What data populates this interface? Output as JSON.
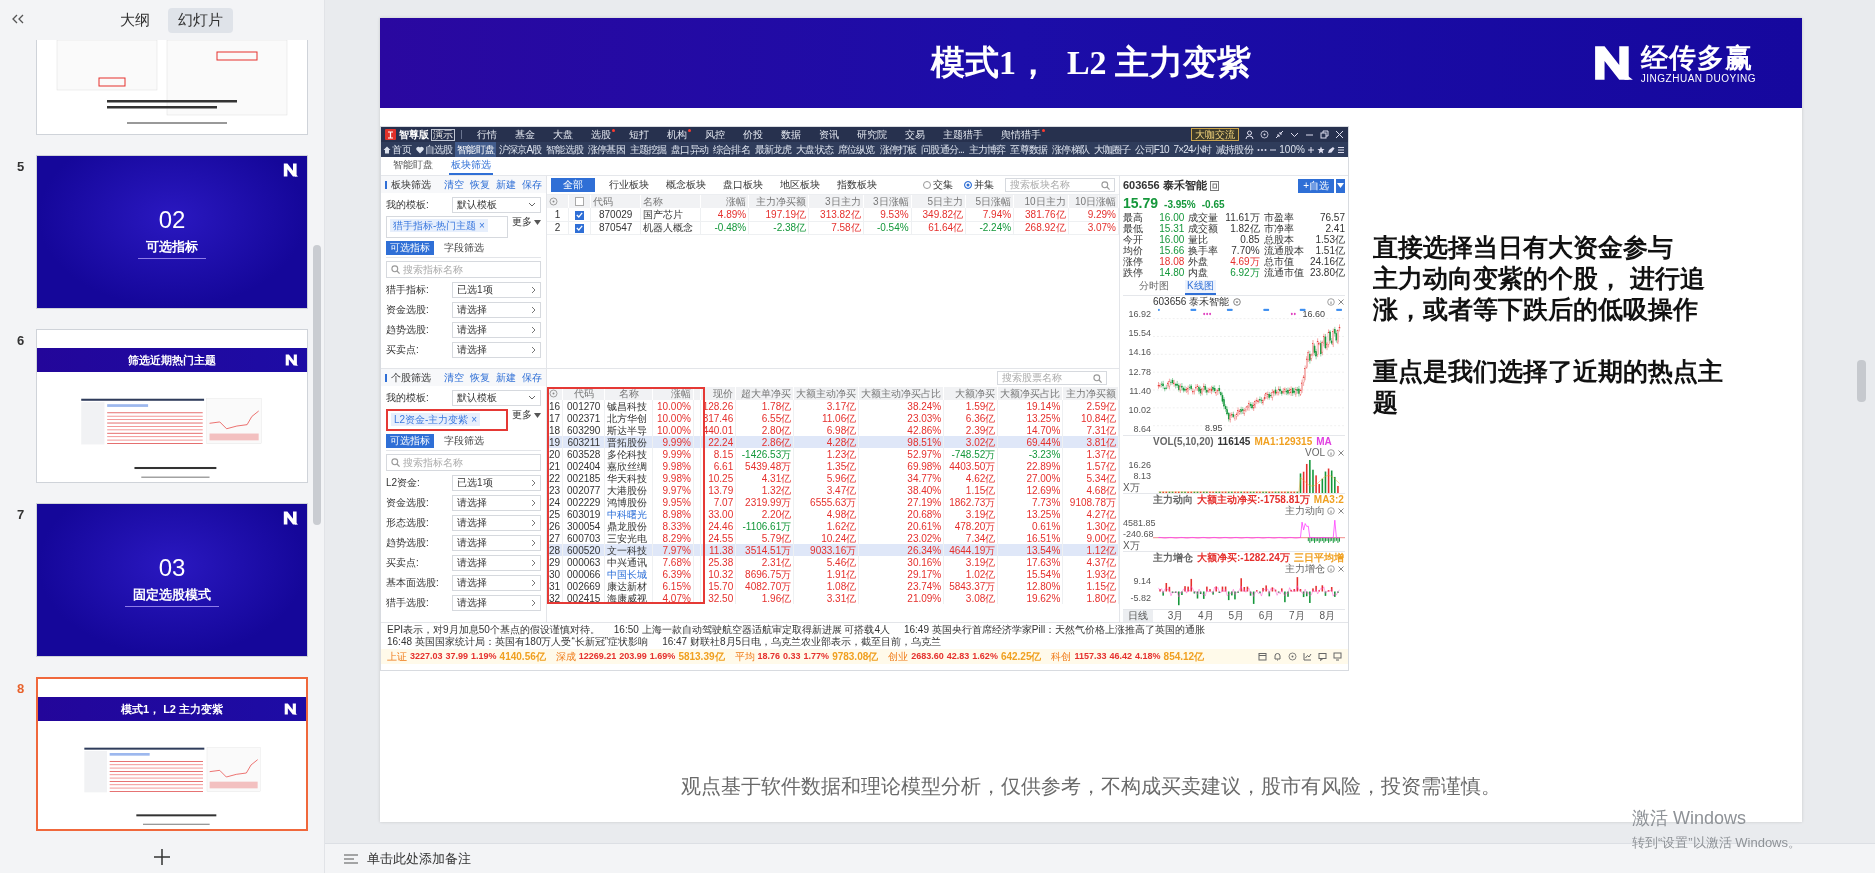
{
  "left_panel": {
    "tabs": [
      {
        "label": "大纲",
        "selected": false
      },
      {
        "label": "幻灯片",
        "selected": true
      }
    ],
    "slides": [
      {
        "kind": "partial",
        "selected": false
      },
      {
        "kind": "section",
        "number": "5",
        "heading": "02",
        "title": "可选指标",
        "selected": false
      },
      {
        "kind": "content",
        "number": "6",
        "title": "筛选近期热门主题",
        "selected": false
      },
      {
        "kind": "section",
        "number": "7",
        "heading": "03",
        "title": "固定选股模式",
        "selected": false
      },
      {
        "kind": "content",
        "number": "8",
        "title": "模式1， L2 主力变紫",
        "selected": true
      }
    ]
  },
  "notes": {
    "placeholder": "单击此处添加备注"
  },
  "activation": {
    "title": "激活 Windows",
    "hint": "转到“设置”以激活 Windows。"
  },
  "slide": {
    "title": "模式1，  L2 主力变紫",
    "logo": {
      "name": "经传多赢",
      "subtitle": "JINGZHUAN DUOYING"
    },
    "paragraphs": [
      [
        "直接选择当日有大资金参与",
        "主力动向变紫的个股， 进行追",
        "涨，或者等下跌后的低吸操作"
      ],
      [
        "重点是我们选择了近期的热点主",
        "题"
      ]
    ],
    "footer": "观点基于软件数据和理论模型分析，仅供参考，不构成买卖建议，股市有风险，投资需谨慎。"
  },
  "app": {
    "brand": "智尊版",
    "badge": "演示",
    "menu": [
      {
        "label": "行情",
        "dot": false
      },
      {
        "label": "基金",
        "dot": false
      },
      {
        "label": "大盘",
        "dot": false
      },
      {
        "label": "选股",
        "dot": true
      },
      {
        "label": "短打",
        "dot": false
      },
      {
        "label": "机构",
        "dot": true
      },
      {
        "label": "风控",
        "dot": false
      },
      {
        "label": "价投",
        "dot": false
      },
      {
        "label": "数据",
        "dot": false
      },
      {
        "label": "资讯",
        "dot": false
      },
      {
        "label": "研究院",
        "dot": false
      },
      {
        "label": "交易",
        "dot": false
      },
      {
        "label": "主题猎手",
        "dot": false
      },
      {
        "label": "舆情猎手",
        "dot": true
      }
    ],
    "community_button": "大咖交流",
    "nav": [
      {
        "label": "首页",
        "selected": false
      },
      {
        "label": "自选股",
        "selected": false
      },
      {
        "label": "智能盯盘",
        "selected": true
      },
      {
        "label": "沪深京A股",
        "selected": false
      },
      {
        "label": "智能选股",
        "selected": false
      },
      {
        "label": "涨停基因",
        "selected": false
      },
      {
        "label": "主题挖掘",
        "selected": false
      },
      {
        "label": "盘口异动",
        "selected": false
      },
      {
        "label": "综合排名",
        "selected": false
      },
      {
        "label": "最新龙虎",
        "selected": false
      },
      {
        "label": "大盘状态",
        "selected": false
      },
      {
        "label": "席位纵览",
        "selected": false
      },
      {
        "label": "涨停打板",
        "selected": false
      },
      {
        "label": "问股通分...",
        "selected": false
      },
      {
        "label": "主力博弈",
        "selected": false
      },
      {
        "label": "至尊数据",
        "selected": false
      },
      {
        "label": "涨停梯队",
        "selected": false
      },
      {
        "label": "大咖圈子",
        "selected": false
      },
      {
        "label": "公司F10",
        "selected": false
      },
      {
        "label": "7×24小时",
        "selected": false
      },
      {
        "label": "减持股份",
        "selected": false
      }
    ],
    "zoom": "100%",
    "tabs": [
      {
        "label": "智能盯盘",
        "selected": false
      },
      {
        "label": "板块筛选",
        "selected": true
      }
    ],
    "sector_filter": {
      "title": "板块筛选",
      "actions": [
        "清空",
        "恢复",
        "新建",
        "保存"
      ],
      "template_label": "我的模板:",
      "template": "默认模板",
      "tag": "猎手指标-热门主题 ×",
      "tag_highlighted": false,
      "more": "更多",
      "tabs": [
        {
          "label": "可选指标",
          "selected": true
        },
        {
          "label": "字段筛选",
          "selected": false
        }
      ],
      "search_placeholder": "搜索指标名称",
      "rows": [
        {
          "label": "猎手指标:",
          "value": "已选1项"
        },
        {
          "label": "资金选股:",
          "value": "请选择"
        },
        {
          "label": "趋势选股:",
          "value": "请选择"
        },
        {
          "label": "买卖点:",
          "value": "请选择"
        }
      ]
    },
    "stock_filter": {
      "title": "个股筛选",
      "actions": [
        "清空",
        "恢复",
        "新建",
        "保存"
      ],
      "template_label": "我的模板:",
      "template": "默认模板",
      "tag": "L2资金-主力变紫 ×",
      "tag_highlighted": true,
      "more": "更多",
      "tabs": [
        {
          "label": "可选指标",
          "selected": true
        },
        {
          "label": "字段筛选",
          "selected": false
        }
      ],
      "search_placeholder": "搜索指标名称",
      "rows": [
        {
          "label": "L2资金:",
          "value": "已选1项"
        },
        {
          "label": "资金选股:",
          "value": "请选择"
        },
        {
          "label": "形态选股:",
          "value": "请选择"
        },
        {
          "label": "趋势选股:",
          "value": "请选择"
        },
        {
          "label": "买卖点:",
          "value": "请选择"
        },
        {
          "label": "基本面选股:",
          "value": "请选择"
        },
        {
          "label": "猎手选股:",
          "value": "请选择"
        }
      ]
    },
    "sector_table": {
      "categories": [
        {
          "label": "全部",
          "selected": true
        },
        {
          "label": "行业板块",
          "selected": false
        },
        {
          "label": "概念板块",
          "selected": false
        },
        {
          "label": "盘口板块",
          "selected": false
        },
        {
          "label": "地区板块",
          "selected": false
        },
        {
          "label": "指数板块",
          "selected": false
        }
      ],
      "modes": [
        {
          "label": "交集",
          "selected": false
        },
        {
          "label": "并集",
          "selected": true
        }
      ],
      "search_placeholder": "搜索板块名称",
      "all_checked": false,
      "columns": [
        "代码",
        "名称",
        "涨幅",
        "主力净买额",
        "3日主力",
        "3日涨幅",
        "5日主力",
        "5日涨幅",
        "10日主力",
        "10日涨幅"
      ],
      "rows": [
        {
          "index": "1",
          "checked": true,
          "cells": [
            {
              "text": "870029"
            },
            {
              "text": "国产芯片"
            },
            {
              "text": "4.89%",
              "up": true
            },
            {
              "text": "197.19亿",
              "up": true
            },
            {
              "text": "313.82亿",
              "up": true
            },
            {
              "text": "9.53%",
              "up": true
            },
            {
              "text": "349.82亿",
              "up": true
            },
            {
              "text": "7.94%",
              "up": true
            },
            {
              "text": "381.76亿",
              "up": true
            },
            {
              "text": "9.29%",
              "up": true
            }
          ]
        },
        {
          "index": "2",
          "checked": true,
          "cells": [
            {
              "text": "870547"
            },
            {
              "text": "机器人概念"
            },
            {
              "text": "-0.48%",
              "up": false
            },
            {
              "text": "-2.38亿",
              "up": false
            },
            {
              "text": "7.58亿",
              "up": true
            },
            {
              "text": "-0.54%",
              "up": false
            },
            {
              "text": "61.64亿",
              "up": true
            },
            {
              "text": "-2.24%",
              "up": false
            },
            {
              "text": "268.92亿",
              "up": true
            },
            {
              "text": "3.07%",
              "up": true
            }
          ]
        }
      ]
    },
    "stock_table": {
      "search_placeholder": "搜索股票名称",
      "highlighted": true,
      "columns": [
        "代码",
        "名称",
        "涨幅",
        "现价",
        "超大单净买",
        "大额主动净买",
        "大额主动净买占比",
        "大额净买",
        "大额净买占比",
        "主力净买额"
      ],
      "rows": [
        {
          "index": "16",
          "selected": false,
          "cells": [
            {
              "text": "001270"
            },
            {
              "text": "铖昌科技"
            },
            {
              "text": "10.00%",
              "up": true
            },
            {
              "text": "128.26",
              "up": true
            },
            {
              "text": "1.78亿",
              "up": true
            },
            {
              "text": "3.17亿",
              "up": true
            },
            {
              "text": "38.24%",
              "up": true
            },
            {
              "text": "1.59亿",
              "up": true
            },
            {
              "text": "19.14%",
              "up": true
            },
            {
              "text": "2.59亿",
              "up": true
            }
          ]
        },
        {
          "index": "17",
          "selected": false,
          "cells": [
            {
              "text": "002371"
            },
            {
              "text": "北方华创"
            },
            {
              "text": "10.00%",
              "up": true
            },
            {
              "text": "317.46",
              "up": true
            },
            {
              "text": "6.55亿",
              "up": true
            },
            {
              "text": "11.06亿",
              "up": true
            },
            {
              "text": "23.03%",
              "up": true
            },
            {
              "text": "6.36亿",
              "up": true
            },
            {
              "text": "13.25%",
              "up": true
            },
            {
              "text": "10.84亿",
              "up": true
            }
          ]
        },
        {
          "index": "18",
          "selected": false,
          "cells": [
            {
              "text": "603290"
            },
            {
              "text": "斯达半导"
            },
            {
              "text": "10.00%",
              "up": true
            },
            {
              "text": "440.01",
              "up": true
            },
            {
              "text": "2.80亿",
              "up": true
            },
            {
              "text": "6.98亿",
              "up": true
            },
            {
              "text": "42.86%",
              "up": true
            },
            {
              "text": "2.39亿",
              "up": true
            },
            {
              "text": "14.70%",
              "up": true
            },
            {
              "text": "7.31亿",
              "up": true
            }
          ]
        },
        {
          "index": "19",
          "selected": true,
          "cells": [
            {
              "text": "603211"
            },
            {
              "text": "晋拓股份"
            },
            {
              "text": "9.99%",
              "up": true
            },
            {
              "text": "22.24",
              "up": true
            },
            {
              "text": "2.86亿",
              "up": true
            },
            {
              "text": "4.28亿",
              "up": true
            },
            {
              "text": "98.51%",
              "up": true
            },
            {
              "text": "3.02亿",
              "up": true
            },
            {
              "text": "69.44%",
              "up": true
            },
            {
              "text": "3.81亿",
              "up": true
            }
          ]
        },
        {
          "index": "20",
          "selected": false,
          "cells": [
            {
              "text": "603528"
            },
            {
              "text": "多伦科技"
            },
            {
              "text": "9.99%",
              "up": true
            },
            {
              "text": "8.15",
              "up": true
            },
            {
              "text": "-1426.53万",
              "up": false
            },
            {
              "text": "1.23亿",
              "up": true
            },
            {
              "text": "52.97%",
              "up": true
            },
            {
              "text": "-748.52万",
              "up": false
            },
            {
              "text": "-3.23%",
              "up": false
            },
            {
              "text": "1.37亿",
              "up": true
            }
          ]
        },
        {
          "index": "21",
          "selected": false,
          "cells": [
            {
              "text": "002404"
            },
            {
              "text": "嘉欣丝绸"
            },
            {
              "text": "9.98%",
              "up": true
            },
            {
              "text": "6.61",
              "up": true
            },
            {
              "text": "5439.48万",
              "up": true
            },
            {
              "text": "1.35亿",
              "up": true
            },
            {
              "text": "69.98%",
              "up": true
            },
            {
              "text": "4403.50万",
              "up": true
            },
            {
              "text": "22.89%",
              "up": true
            },
            {
              "text": "1.57亿",
              "up": true
            }
          ]
        },
        {
          "index": "22",
          "selected": false,
          "cells": [
            {
              "text": "002185"
            },
            {
              "text": "华天科技"
            },
            {
              "text": "9.98%",
              "up": true
            },
            {
              "text": "10.25",
              "up": true
            },
            {
              "text": "4.31亿",
              "up": true
            },
            {
              "text": "5.96亿",
              "up": true
            },
            {
              "text": "34.77%",
              "up": true
            },
            {
              "text": "4.62亿",
              "up": true
            },
            {
              "text": "27.00%",
              "up": true
            },
            {
              "text": "5.34亿",
              "up": true
            }
          ]
        },
        {
          "index": "23",
          "selected": false,
          "cells": [
            {
              "text": "002077"
            },
            {
              "text": "大港股份"
            },
            {
              "text": "9.97%",
              "up": true
            },
            {
              "text": "13.79",
              "up": true
            },
            {
              "text": "1.32亿",
              "up": true
            },
            {
              "text": "3.47亿",
              "up": true
            },
            {
              "text": "38.40%",
              "up": true
            },
            {
              "text": "1.15亿",
              "up": true
            },
            {
              "text": "12.69%",
              "up": true
            },
            {
              "text": "4.68亿",
              "up": true
            }
          ]
        },
        {
          "index": "24",
          "selected": false,
          "cells": [
            {
              "text": "002229"
            },
            {
              "text": "鸿博股份"
            },
            {
              "text": "9.95%",
              "up": true
            },
            {
              "text": "7.07",
              "up": true
            },
            {
              "text": "2319.99万",
              "up": true
            },
            {
              "text": "6555.63万",
              "up": true
            },
            {
              "text": "27.19%",
              "up": true
            },
            {
              "text": "1862.73万",
              "up": true
            },
            {
              "text": "7.73%",
              "up": true
            },
            {
              "text": "9108.78万",
              "up": true
            }
          ]
        },
        {
          "index": "25",
          "selected": false,
          "cells": [
            {
              "text": "603019"
            },
            {
              "text": "中科曙光",
              "marked": true
            },
            {
              "text": "8.98%",
              "up": true
            },
            {
              "text": "33.00",
              "up": true
            },
            {
              "text": "2.20亿",
              "up": true
            },
            {
              "text": "4.98亿",
              "up": true
            },
            {
              "text": "20.68%",
              "up": true
            },
            {
              "text": "3.19亿",
              "up": true
            },
            {
              "text": "13.25%",
              "up": true
            },
            {
              "text": "4.27亿",
              "up": true
            }
          ]
        },
        {
          "index": "26",
          "selected": false,
          "cells": [
            {
              "text": "300054"
            },
            {
              "text": "鼎龙股份"
            },
            {
              "text": "8.33%",
              "up": true
            },
            {
              "text": "24.46",
              "up": true
            },
            {
              "text": "-1106.61万",
              "up": false
            },
            {
              "text": "1.62亿",
              "up": true
            },
            {
              "text": "20.61%",
              "up": true
            },
            {
              "text": "478.20万",
              "up": true
            },
            {
              "text": "0.61%",
              "up": true
            },
            {
              "text": "1.30亿",
              "up": true
            }
          ]
        },
        {
          "index": "27",
          "selected": false,
          "cells": [
            {
              "text": "600703"
            },
            {
              "text": "三安光电"
            },
            {
              "text": "8.29%",
              "up": true
            },
            {
              "text": "24.55",
              "up": true
            },
            {
              "text": "5.79亿",
              "up": true
            },
            {
              "text": "10.24亿",
              "up": true
            },
            {
              "text": "23.02%",
              "up": true
            },
            {
              "text": "7.34亿",
              "up": true
            },
            {
              "text": "16.51%",
              "up": true
            },
            {
              "text": "9.00亿",
              "up": true
            }
          ]
        },
        {
          "index": "28",
          "selected": true,
          "cells": [
            {
              "text": "600520"
            },
            {
              "text": "文一科技"
            },
            {
              "text": "7.97%",
              "up": true
            },
            {
              "text": "11.38",
              "up": true
            },
            {
              "text": "3514.51万",
              "up": true
            },
            {
              "text": "9033.16万",
              "up": true
            },
            {
              "text": "26.34%",
              "up": true
            },
            {
              "text": "4644.19万",
              "up": true
            },
            {
              "text": "13.54%",
              "up": true
            },
            {
              "text": "1.12亿",
              "up": true
            }
          ]
        },
        {
          "index": "29",
          "selected": false,
          "cells": [
            {
              "text": "000063"
            },
            {
              "text": "中兴通讯"
            },
            {
              "text": "7.68%",
              "up": true
            },
            {
              "text": "25.38",
              "up": true
            },
            {
              "text": "2.31亿",
              "up": true
            },
            {
              "text": "5.46亿",
              "up": true
            },
            {
              "text": "30.16%",
              "up": true
            },
            {
              "text": "3.19亿",
              "up": true
            },
            {
              "text": "17.63%",
              "up": true
            },
            {
              "text": "4.37亿",
              "up": true
            }
          ]
        },
        {
          "index": "30",
          "selected": false,
          "cells": [
            {
              "text": "000066"
            },
            {
              "text": "中国长城",
              "marked": true
            },
            {
              "text": "6.39%",
              "up": true
            },
            {
              "text": "10.32",
              "up": true
            },
            {
              "text": "8696.75万",
              "up": true
            },
            {
              "text": "1.91亿",
              "up": true
            },
            {
              "text": "29.17%",
              "up": true
            },
            {
              "text": "1.02亿",
              "up": true
            },
            {
              "text": "15.54%",
              "up": true
            },
            {
              "text": "1.93亿",
              "up": true
            }
          ]
        },
        {
          "index": "31",
          "selected": false,
          "cells": [
            {
              "text": "002669"
            },
            {
              "text": "康达新材"
            },
            {
              "text": "6.15%",
              "up": true
            },
            {
              "text": "15.70",
              "up": true
            },
            {
              "text": "4082.70万",
              "up": true
            },
            {
              "text": "1.08亿",
              "up": true
            },
            {
              "text": "23.74%",
              "up": true
            },
            {
              "text": "5843.37万",
              "up": true
            },
            {
              "text": "12.80%",
              "up": true
            },
            {
              "text": "1.15亿",
              "up": true
            }
          ]
        },
        {
          "index": "32",
          "selected": false,
          "cells": [
            {
              "text": "002415"
            },
            {
              "text": "海康威视"
            },
            {
              "text": "4.07%",
              "up": true
            },
            {
              "text": "32.50",
              "up": true
            },
            {
              "text": "1.96亿",
              "up": true
            },
            {
              "text": "3.31亿",
              "up": true
            },
            {
              "text": "21.09%",
              "up": true
            },
            {
              "text": "3.08亿",
              "up": true
            },
            {
              "text": "19.62%",
              "up": true
            },
            {
              "text": "1.80亿",
              "up": true
            }
          ]
        }
      ]
    },
    "quote": {
      "title": "603656 泰禾智能",
      "watch_button": "+自选",
      "price": "15.79",
      "change_pct": "-3.95%",
      "change": "-0.65",
      "up": false,
      "stats": [
        {
          "label": "最高",
          "value": "16.00",
          "up": false
        },
        {
          "label": "成交量",
          "value": "11.61万"
        },
        {
          "label": "市盈率",
          "value": "76.57"
        },
        {
          "label": "最低",
          "value": "15.31",
          "up": false
        },
        {
          "label": "成交额",
          "value": "1.82亿"
        },
        {
          "label": "市净率",
          "value": "2.41"
        },
        {
          "label": "今开",
          "value": "16.00",
          "up": false
        },
        {
          "label": "量比",
          "value": "0.85"
        },
        {
          "label": "总股本",
          "value": "1.53亿"
        },
        {
          "label": "均价",
          "value": "15.66",
          "up": false
        },
        {
          "label": "换手率",
          "value": "7.70%"
        },
        {
          "label": "流通股本",
          "value": "1.51亿"
        },
        {
          "label": "涨停",
          "value": "18.08",
          "up": true
        },
        {
          "label": "外盘",
          "value": "4.69万",
          "up": true
        },
        {
          "label": "总市值",
          "value": "24.16亿"
        },
        {
          "label": "跌停",
          "value": "14.80",
          "up": false
        },
        {
          "label": "内盘",
          "value": "6.92万",
          "up": false
        },
        {
          "label": "流通市值",
          "value": "23.80亿"
        }
      ],
      "chart_tabs": [
        {
          "label": "分时图",
          "selected": false
        },
        {
          "label": "K线图",
          "selected": true
        }
      ],
      "kline": {
        "label": "603656 泰禾智能",
        "ticks": [
          "16.92",
          "15.54",
          "14.16",
          "12.78",
          "11.40",
          "10.02",
          "8.64"
        ],
        "high_mark": "16.60",
        "low_mark": "8.95"
      },
      "indicators": [
        {
          "kind": "volume",
          "legend": [
            {
              "text": "VOL(5,10,20)",
              "color": "#666666"
            },
            {
              "text": "116145",
              "color": "#333333"
            },
            {
              "text": "MA1:129315",
              "color": "#f0a020"
            },
            {
              "text": "MA",
              "color": "#e040e0"
            }
          ],
          "name": "VOL",
          "ticks": [
            "16.26",
            "8.13"
          ],
          "unit": "X万"
        },
        {
          "kind": "flow",
          "legend": [
            {
              "text": "主力动向",
              "color": "#666666"
            },
            {
              "text": "大额主动净买:-1758.81万",
              "color": "#e5302d"
            },
            {
              "text": "MA3:2",
              "color": "#f0a020"
            }
          ],
          "name": "主力动向",
          "ticks": [
            "4581.85",
            "-240.68"
          ],
          "unit": "X万"
        },
        {
          "kind": "position",
          "legend": [
            {
              "text": "主力增仓",
              "color": "#666666"
            },
            {
              "text": "大额净买:-1282.24万",
              "color": "#e5302d"
            },
            {
              "text": "三日平均增",
              "color": "#f0a020"
            }
          ],
          "name": "主力增仓",
          "ticks": [
            "9.14",
            "-5.82"
          ]
        }
      ],
      "x_axis": [
        "日线",
        "3月",
        "4月",
        "5月",
        "6月",
        "7月",
        "8月"
      ]
    },
    "news": [
      "EPI表示，对9月加息50个基点的假设谨慎对待。",
      "16:50 上海一款自动驾驶航空器适航审定取得新进展 可搭载4人",
      "16:49 英国央行首席经济学家Pill：天然气价格上涨推高了英国的通胀",
      "16:48 英国国家统计局：英国有180万人受“长新冠”症状影响",
      "16:47 财联社8月5日电，乌克兰农业部表示，截至目前，乌克兰"
    ],
    "indices": [
      {
        "name": "上证",
        "values": [
          "3227.03",
          "37.99",
          "1.19%"
        ],
        "amount": "4140.56亿",
        "up": true
      },
      {
        "name": "深成",
        "values": [
          "12269.21",
          "203.99",
          "1.69%"
        ],
        "amount": "5813.39亿",
        "up": true
      },
      {
        "name": "平均",
        "values": [
          "18.76",
          "0.33",
          "1.77%"
        ],
        "amount": "9783.08亿",
        "up": true
      },
      {
        "name": "创业",
        "values": [
          "2683.60",
          "42.83",
          "1.62%"
        ],
        "amount": "642.25亿",
        "up": true
      },
      {
        "name": "科创",
        "values": [
          "1157.33",
          "46.42",
          "4.18%"
        ],
        "amount": "854.12亿",
        "up": true
      }
    ]
  }
}
